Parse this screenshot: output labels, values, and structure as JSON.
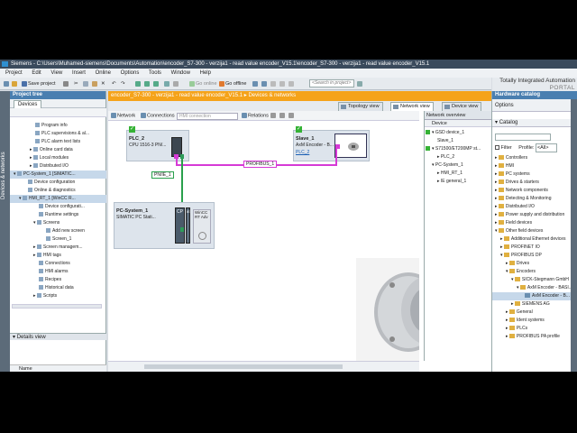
{
  "window": {
    "title": "Siemens  -  C:\\Users\\Muhamed-siemens\\Documents\\Automation\\encoder_S7-300 - verzija1 - read value encoder_V15.1\\encoder_S7-300 - verzija1 - read value encoder_V15.1"
  },
  "menu": [
    "Project",
    "Edit",
    "View",
    "Insert",
    "Online",
    "Options",
    "Tools",
    "Window",
    "Help"
  ],
  "toolbar": {
    "save_label": "Save project",
    "go_online": "Go online",
    "go_offline": "Go offline",
    "search_placeholder": "<Search in project>"
  },
  "brand": {
    "line1": "Totally Integrated Automation",
    "line2": "PORTAL"
  },
  "sidebar": {
    "vertical_label": "Devices & networks"
  },
  "project_tree": {
    "header": "Project tree",
    "tab": "Devices",
    "items": [
      "Program info",
      "PLC supervisions & al...",
      "PLC alarm text lists",
      "Online card data",
      "Local modules",
      "Distributed I/O",
      "PC-System_1 [SIMATIC...",
      "Device configuration",
      "Online & diagnostics",
      "HMI_RT_1 [WinCC R...",
      "Device configurati...",
      "Runtime settings",
      "Screens",
      "Add new screen",
      "Screen_1",
      "Screen managem...",
      "HMI tags",
      "Connections",
      "HMI alarms",
      "Recipes",
      "Historical data",
      "Scripts"
    ],
    "details_view": "Details view",
    "details_column": "Name"
  },
  "editor": {
    "title": "encoder_S7-300 - verzija1 - read value encoder_V15.1  ▸  Devices & networks",
    "tabs": [
      "Topology view",
      "Network view",
      "Device view"
    ],
    "toolbar": {
      "network": "Network",
      "connections": "Connections",
      "connection_select": "HMI connection",
      "relations": "Relations"
    }
  },
  "network": {
    "plc": {
      "name": "PLC_2",
      "type": "CPU 1516-3 PN/..."
    },
    "slave": {
      "name": "Slave_1",
      "type": "AxM Encoder - B...",
      "link": "PLC_2"
    },
    "pc": {
      "name": "PC-System_1",
      "type": "SIMATIC PC Stati...",
      "module_cp": "CP",
      "module_ie": "IE",
      "hmi_label1": "WinCC",
      "hmi_label2": "RT Adv"
    },
    "profibus_label": "PROFIBUS_1",
    "pnie_label": "PN/IE_1"
  },
  "overview": {
    "tab": "Network overview",
    "column": "Device",
    "rows": [
      "GSD device_1",
      "Slave_1",
      "S71500/ET200MP st...",
      "PLC_2",
      "PC-System_1",
      "HMI_RT_1",
      "IE general_1"
    ]
  },
  "catalog": {
    "header": "Hardware catalog",
    "options": "Options",
    "catalog_label": "Catalog",
    "filter_label": "Filter",
    "profile_label": "Profile:",
    "profile_value": "<All>",
    "items": [
      "Controllers",
      "HMI",
      "PC systems",
      "Drives & starters",
      "Network components",
      "Detecting & Monitoring",
      "Distributed I/O",
      "Power supply and distribution",
      "Field devices",
      "Other field devices",
      "Additional Ethernet devices",
      "PROFINET IO",
      "PROFIBUS DP",
      "Drives",
      "Encoders",
      "SICK-Stegmann GmbH",
      "AxM Encoder - BASI...",
      "AxM Encoder - B...",
      "SIEMENS AG",
      "General",
      "Ident systems",
      "PLCs",
      "PROFIBUS PA profile"
    ]
  }
}
